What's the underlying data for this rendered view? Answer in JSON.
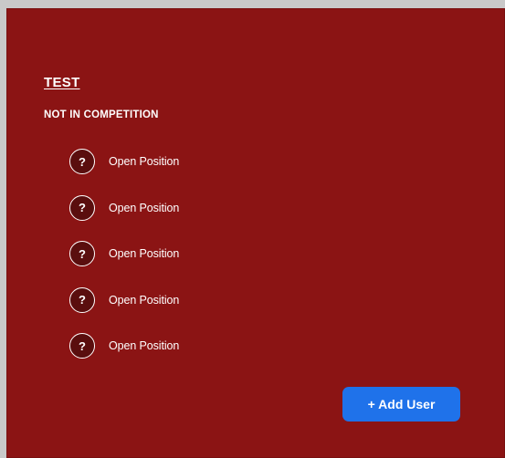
{
  "team": {
    "name": "TEST",
    "status": "NOT IN COMPETITION"
  },
  "members": [
    {
      "avatar": "?",
      "label": "Open Position"
    },
    {
      "avatar": "?",
      "label": "Open Position"
    },
    {
      "avatar": "?",
      "label": "Open Position"
    },
    {
      "avatar": "?",
      "label": "Open Position"
    },
    {
      "avatar": "?",
      "label": "Open Position"
    }
  ],
  "actions": {
    "add_user_label": "+ Add User"
  },
  "colors": {
    "panel_background": "#8b1414",
    "button_accent": "#1f72ea",
    "page_background": "#c9c9c9"
  }
}
